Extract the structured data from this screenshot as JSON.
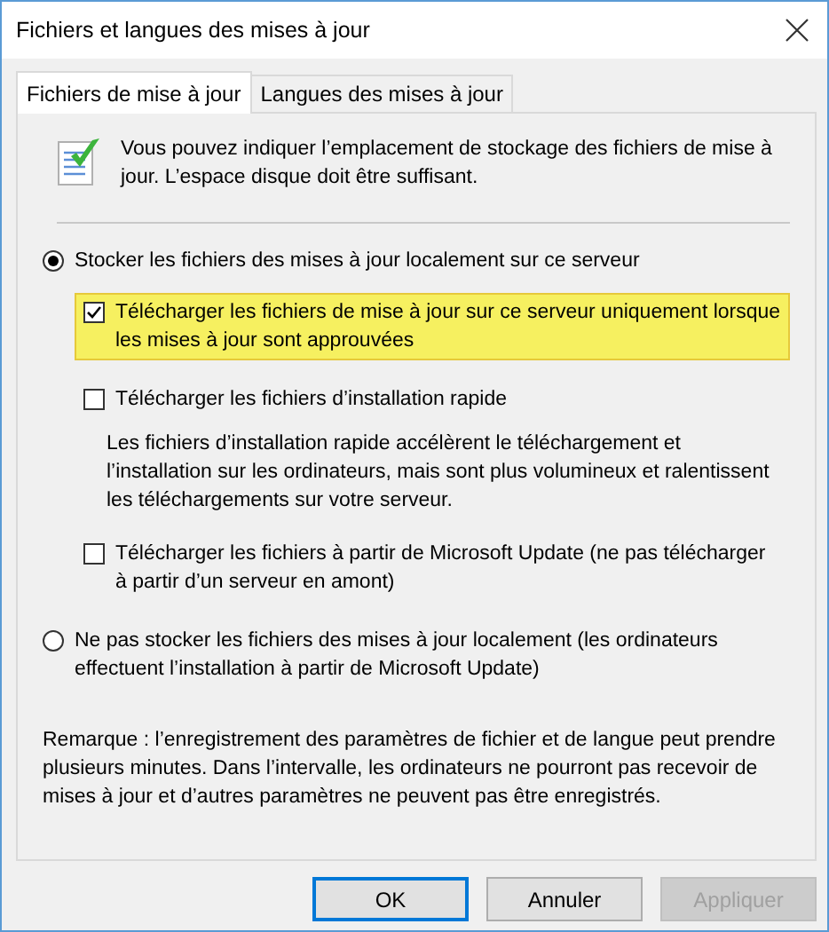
{
  "window": {
    "title": "Fichiers et langues des mises à jour"
  },
  "tabs": [
    {
      "label": "Fichiers de mise à jour",
      "selected": true
    },
    {
      "label": "Langues des mises à jour",
      "selected": false
    }
  ],
  "intro": "Vous pouvez indiquer l’emplacement de stockage des fichiers de mise à jour. L’espace disque doit être suffisant.",
  "options": [
    {
      "kind": "radio",
      "label": "Stocker les fichiers des mises à jour localement sur ce serveur",
      "selected": true,
      "children": [
        {
          "kind": "checkbox",
          "label": "Télécharger les fichiers de mise à jour sur ce serveur uniquement lorsque les mises à jour sont approuvées",
          "checked": true,
          "highlighted": true
        },
        {
          "kind": "checkbox",
          "label": "Télécharger les fichiers d’installation rapide",
          "checked": false,
          "highlighted": false,
          "description": "Les fichiers d’installation rapide accélèrent le téléchargement et l’installation sur les ordinateurs, mais sont plus volumineux et ralentissent les téléchargements sur votre serveur."
        },
        {
          "kind": "checkbox",
          "label": "Télécharger les fichiers à partir de Microsoft Update (ne pas télécharger à partir d’un serveur en amont)",
          "checked": false,
          "highlighted": false
        }
      ]
    },
    {
      "kind": "radio",
      "label": "Ne pas stocker les fichiers des mises à jour localement (les ordinateurs effectuent l’installation à partir de Microsoft Update)",
      "selected": false
    }
  ],
  "note": "Remarque : l’enregistrement des paramètres de fichier et de langue peut prendre plusieurs minutes. Dans l’intervalle, les ordinateurs ne pourront pas recevoir de mises à jour et d’autres paramètres ne peuvent pas être enregistrés.",
  "buttons": [
    {
      "label": "OK",
      "default": true,
      "disabled": false
    },
    {
      "label": "Annuler",
      "default": false,
      "disabled": false
    },
    {
      "label": "Appliquer",
      "default": false,
      "disabled": true
    }
  ]
}
